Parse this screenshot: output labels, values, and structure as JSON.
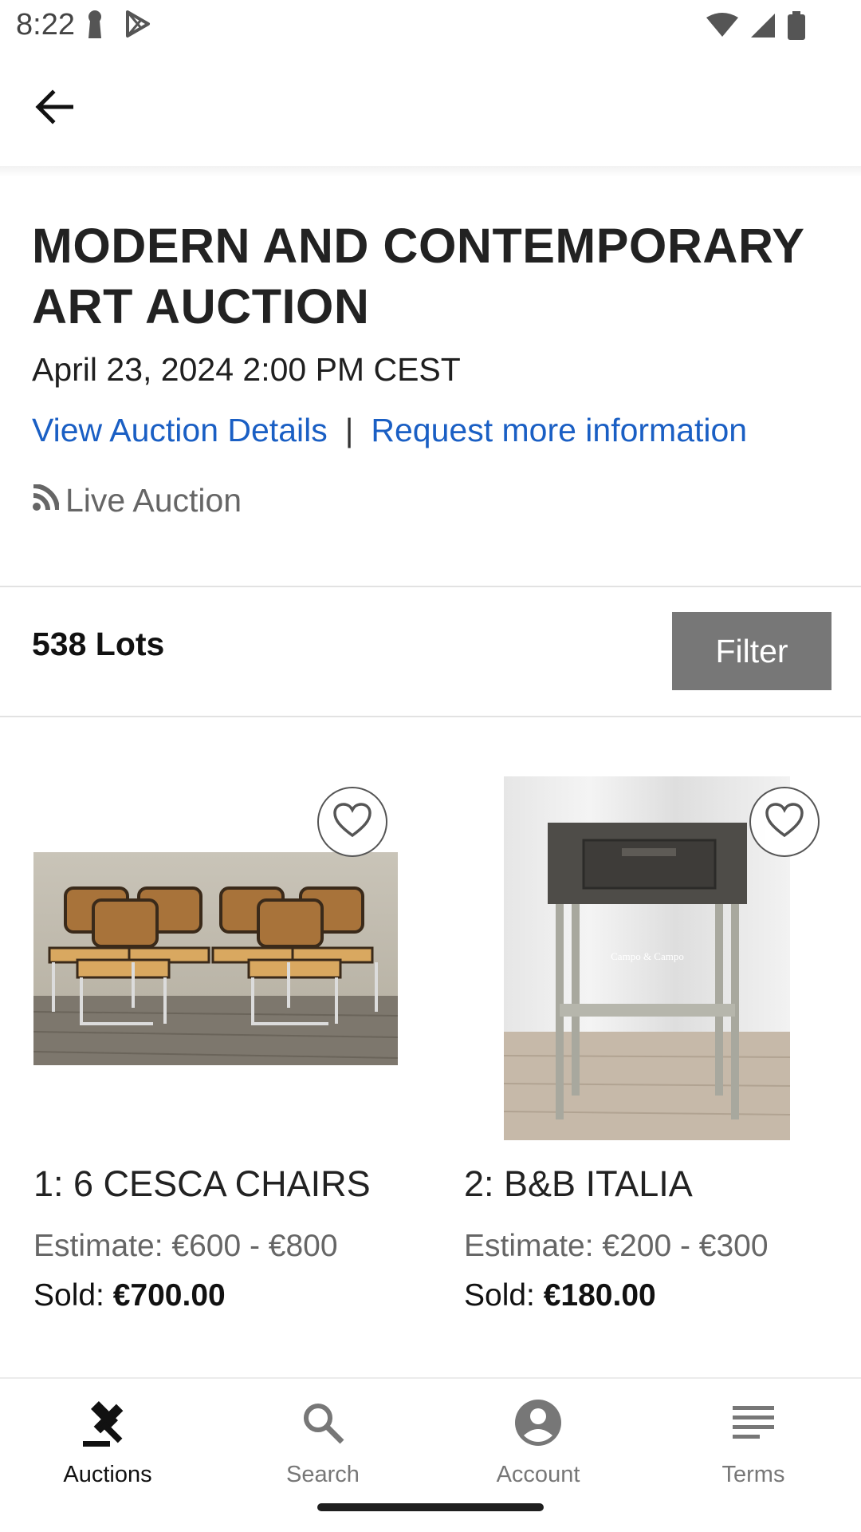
{
  "status_bar": {
    "time": "8:22",
    "left_icons": [
      "keyhole-icon",
      "play-store-icon"
    ],
    "right_icons": [
      "wifi-icon",
      "signal-icon",
      "battery-icon"
    ]
  },
  "app_bar": {
    "back_icon": "arrow-back-icon"
  },
  "auction": {
    "title": "MODERN AND CONTEMPORARY ART AUCTION",
    "date": "April 23, 2024 2:00 PM CEST",
    "details_link": "View Auction Details",
    "separator": "|",
    "info_link": "Request more information",
    "live_label": "Live Auction",
    "live_icon": "rss-icon"
  },
  "lots_bar": {
    "count_label": "538 Lots",
    "filter_label": "Filter"
  },
  "lots": [
    {
      "title": "1: 6 CESCA CHAIRS",
      "estimate": "Estimate: €600 - €800",
      "sold_prefix": "Sold: ",
      "sold_value": "€700.00",
      "image_icon": "chairs-photo"
    },
    {
      "title": "2: B&B ITALIA",
      "estimate": "Estimate: €200 - €300",
      "sold_prefix": "Sold: ",
      "sold_value": "€180.00",
      "image_icon": "nightstand-photo",
      "image_watermark": "Campo & Campo"
    }
  ],
  "bottom_nav": {
    "items": [
      {
        "label": "Auctions",
        "icon": "gavel-icon",
        "active": true
      },
      {
        "label": "Search",
        "icon": "search-icon",
        "active": false
      },
      {
        "label": "Account",
        "icon": "account-icon",
        "active": false
      },
      {
        "label": "Terms",
        "icon": "list-icon",
        "active": false
      }
    ]
  },
  "colors": {
    "link": "#1a5fc4",
    "filter_bg": "#777777",
    "text": "#1f1f1f"
  }
}
